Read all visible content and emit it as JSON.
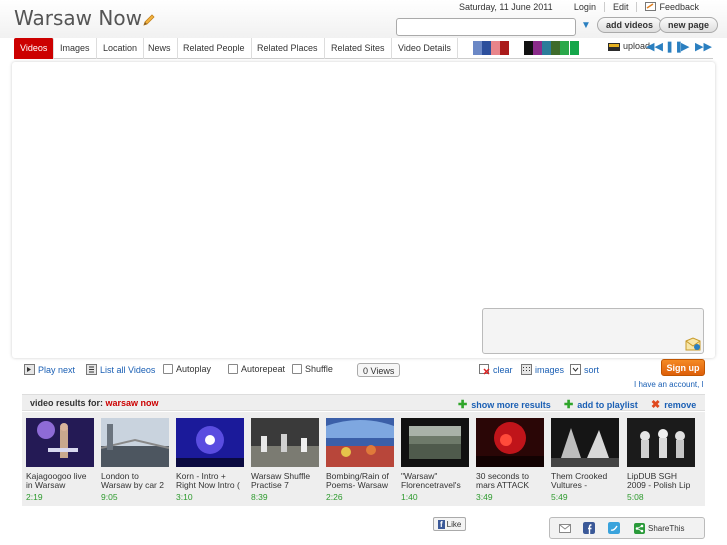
{
  "header": {
    "site_title": "Warsaw Now",
    "date": "Saturday, 11 June 2011",
    "links": [
      "Login",
      "Edit",
      "Feedback"
    ],
    "search_value": "",
    "buttons": {
      "add_videos": "add videos",
      "new_page": "new page"
    }
  },
  "tabs": [
    "Videos",
    "Images",
    "Location",
    "News",
    "Related People",
    "Related Places",
    "Related Sites",
    "Video Details"
  ],
  "active_tab": "Videos",
  "swatches": [
    "#6b88c6",
    "#2c4f9c",
    "#e8848a",
    "#aa1a1a",
    "#ffffff",
    "#111111",
    "#8a2b8a",
    "#2b7c9a",
    "#3e6b2b",
    "#2aa84a",
    "#14a64a"
  ],
  "upload_label": "upload",
  "controls": {
    "play_next": "Play next",
    "list_all": "List all Videos",
    "autoplay": "Autoplay",
    "autorepeat": "Autorepeat",
    "shuffle": "Shuffle",
    "views": "0 Views",
    "clear": "clear",
    "images": "images",
    "sort": "sort",
    "signup": "Sign up",
    "have_account": "I have an account, l"
  },
  "results": {
    "label": "video results for:",
    "query": "warsaw now",
    "show_more": "show more results",
    "add_playlist": "add to playlist",
    "remove": "remove"
  },
  "videos": [
    {
      "title": "Kajagoogoo live in Warsaw",
      "duration": "2:19"
    },
    {
      "title": "London to Warsaw by car 2",
      "duration": "9:05"
    },
    {
      "title": "Korn - Intro + Right Now Intro (",
      "duration": "3:10"
    },
    {
      "title": "Warsaw Shuffle Practise 7",
      "duration": "8:39"
    },
    {
      "title": "Bombing/Rain of Poems- Warsaw",
      "duration": "2:26"
    },
    {
      "title": "\"Warsaw\" Florencetravel's",
      "duration": "1:40"
    },
    {
      "title": "30 seconds to mars ATTACK",
      "duration": "3:49"
    },
    {
      "title": "Them Crooked Vultures -",
      "duration": "5:49"
    },
    {
      "title": "LipDUB SGH 2009 - Polish Lip",
      "duration": "5:08"
    }
  ],
  "social": {
    "like": "Like",
    "share": "ShareThis"
  }
}
